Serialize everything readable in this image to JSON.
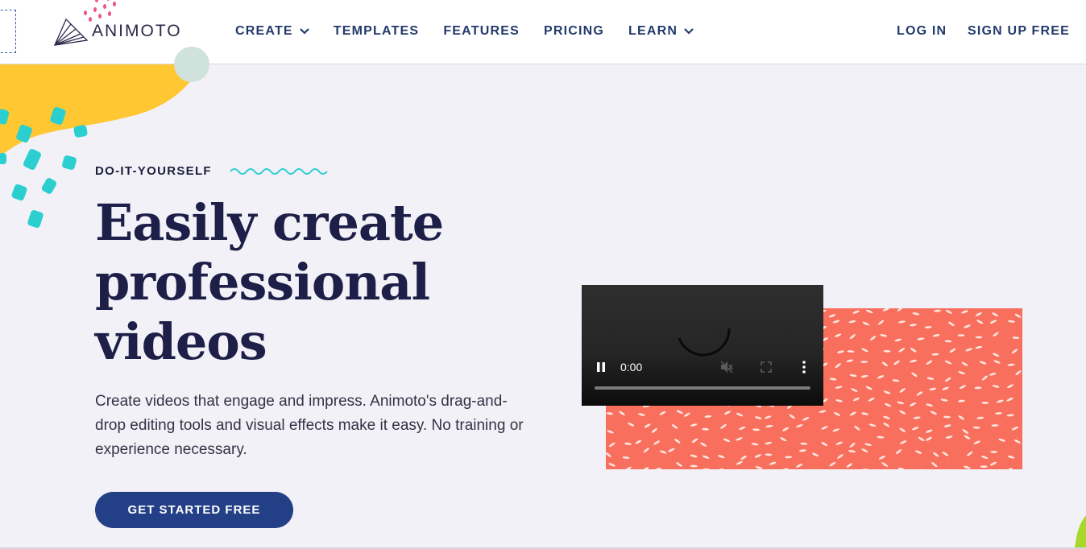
{
  "header": {
    "logo_text": "ANIMOTO",
    "nav": [
      {
        "label": "CREATE",
        "dropdown": true
      },
      {
        "label": "TEMPLATES",
        "dropdown": false
      },
      {
        "label": "FEATURES",
        "dropdown": false
      },
      {
        "label": "PRICING",
        "dropdown": false
      },
      {
        "label": "LEARN",
        "dropdown": true
      }
    ],
    "login_label": "LOG IN",
    "signup_label": "SIGN UP FREE"
  },
  "hero": {
    "eyebrow": "DO-IT-YOURSELF",
    "headline_lines": [
      "Easily create",
      "professional",
      "videos"
    ],
    "description": "Create videos that engage and impress. Animoto's drag-and-drop editing tools and visual effects make it easy. No training or experience necessary.",
    "cta_label": "GET STARTED FREE"
  },
  "video": {
    "time": "0:00",
    "state": "playing",
    "muted": true,
    "progress": 0
  },
  "colors": {
    "brand_navy": "#233f86",
    "nav_text": "#233a6b",
    "headline": "#1d1f48",
    "background": "#f2f1f7",
    "pattern_coral": "#f96f5d",
    "accent_yellow": "#ffc832",
    "accent_teal": "#2ccfd0",
    "accent_pink": "#f0518e"
  },
  "icons": [
    "animoto-logo-icon",
    "chevron-down-icon",
    "squiggle-icon",
    "pause-icon",
    "volume-muted-icon",
    "fullscreen-icon",
    "more-vert-icon",
    "loading-spinner-icon"
  ]
}
